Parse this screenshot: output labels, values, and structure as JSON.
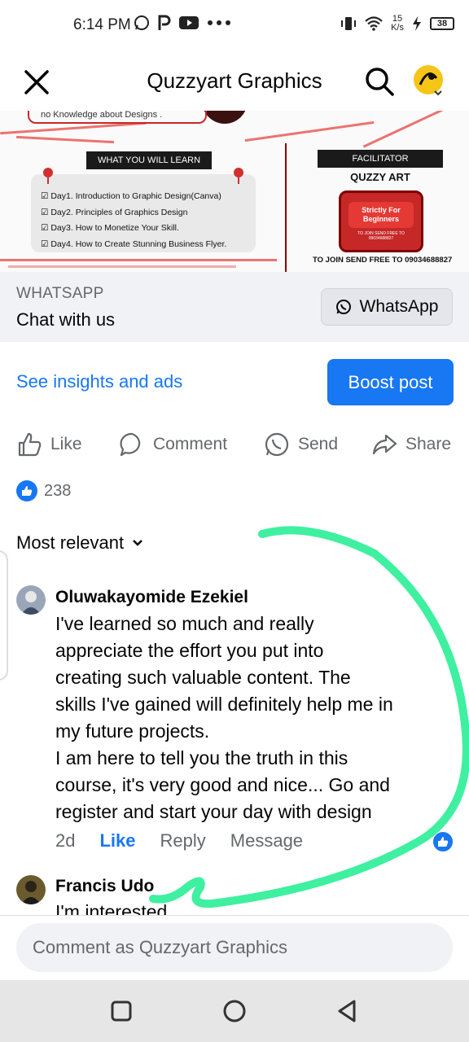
{
  "status_bar": {
    "time": "6:14 PM",
    "net_speed_value": "15",
    "net_speed_unit": "K/s",
    "battery": "38"
  },
  "header": {
    "title": "Quzzyart Graphics"
  },
  "banner": {
    "top_text": "no Knowledge about Designs .",
    "learn_title": "WHAT YOU WILL LEARN",
    "learn_items": [
      "Day1.  Introduction to Graphic Design(Canva)",
      "Day2. Principles of Graphics Design",
      "Day3. How to Monetize Your Skill.",
      "Day4. How to Create Stunning Business Flyer."
    ],
    "facilitator_title": "FACILITATOR",
    "facilitator_name": "QUZZY ART",
    "strict_line1": "Strictly For",
    "strict_line2": "Beginners",
    "strict_small": "TO JOIN SEND FREE TO 09034688827",
    "join_text": "TO JOIN SEND FREE TO 09034688827"
  },
  "whatsapp": {
    "label": "WHATSAPP",
    "subtitle": "Chat with us",
    "button_label": "WhatsApp"
  },
  "insights": {
    "link_label": "See insights and ads",
    "boost_label": "Boost post"
  },
  "actions": {
    "like": "Like",
    "comment": "Comment",
    "send": "Send",
    "share": "Share"
  },
  "reactions": {
    "count": "238"
  },
  "sort": {
    "label": "Most relevant"
  },
  "comments": [
    {
      "author": "Oluwakayomide Ezekiel",
      "lines": [
        "I've learned so much and really",
        "appreciate the effort you put into",
        "creating such valuable content. The",
        "skills I've gained will definitely help me in",
        "my future projects.",
        "I am here to tell you the truth in this",
        "course, it's very good and nice... Go and",
        "register and start your day with design"
      ],
      "time": "2d",
      "like": "Like",
      "reply": "Reply",
      "message": "Message"
    },
    {
      "author": "Francis Udo",
      "text": "I'm interested"
    }
  ],
  "comment_input": {
    "placeholder": "Comment as Quzzyart Graphics"
  },
  "colors": {
    "fb_blue": "#1877f2",
    "highlight_stroke": "#3ef0a0"
  }
}
